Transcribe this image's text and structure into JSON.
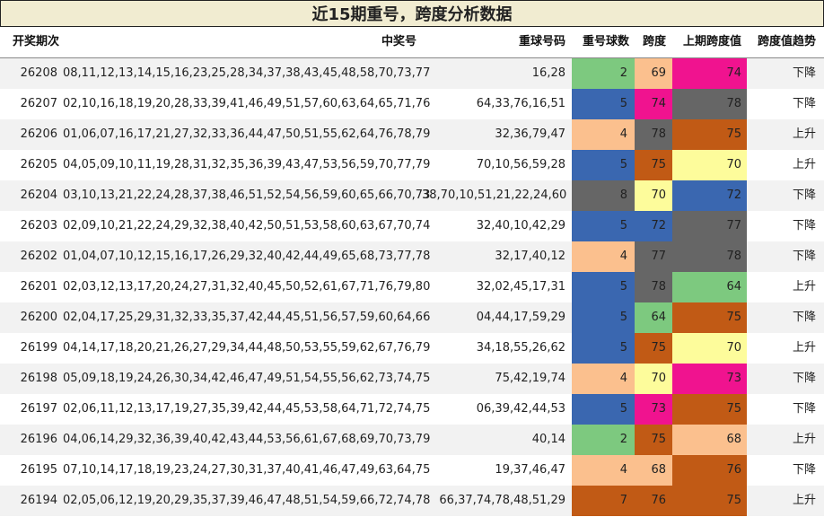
{
  "title": "近15期重号，跨度分析数据",
  "headers": {
    "period": "开奖期次",
    "main": "中奖号",
    "heavy": "重球号码",
    "count": "重号球数",
    "span": "跨度",
    "prev_span": "上期跨度值",
    "trend": "跨度值趋势"
  },
  "colors": {
    "green": "#7dc97f",
    "blue": "#3a67b0",
    "peach": "#fbc08e",
    "gray": "#666666",
    "magenta": "#f0138f",
    "orange": "#c15a15",
    "yellow": "#fdfc9b"
  },
  "rows": [
    {
      "period": "26208",
      "main": "08,11,12,13,14,15,16,23,25,28,34,37,38,43,45,48,58,70,73,77",
      "heavy": "16,28",
      "count": "2",
      "count_color": "green",
      "span": "69",
      "span_color": "peach",
      "prev_span": "74",
      "prev_color": "magenta",
      "trend": "下降"
    },
    {
      "period": "26207",
      "main": "02,10,16,18,19,20,28,33,39,41,46,49,51,57,60,63,64,65,71,76",
      "heavy": "64,33,76,16,51",
      "count": "5",
      "count_color": "blue",
      "span": "74",
      "span_color": "magenta",
      "prev_span": "78",
      "prev_color": "gray",
      "trend": "下降"
    },
    {
      "period": "26206",
      "main": "01,06,07,16,17,21,27,32,33,36,44,47,50,51,55,62,64,76,78,79",
      "heavy": "32,36,79,47",
      "count": "4",
      "count_color": "peach",
      "span": "78",
      "span_color": "gray",
      "prev_span": "75",
      "prev_color": "orange",
      "trend": "上升"
    },
    {
      "period": "26205",
      "main": "04,05,09,10,11,19,28,31,32,35,36,39,43,47,53,56,59,70,77,79",
      "heavy": "70,10,56,59,28",
      "count": "5",
      "count_color": "blue",
      "span": "75",
      "span_color": "orange",
      "prev_span": "70",
      "prev_color": "yellow",
      "trend": "上升"
    },
    {
      "period": "26204",
      "main": "03,10,13,21,22,24,28,37,38,46,51,52,54,56,59,60,65,66,70,73",
      "heavy": "38,70,10,51,21,22,24,60",
      "count": "8",
      "count_color": "gray",
      "span": "70",
      "span_color": "yellow",
      "prev_span": "72",
      "prev_color": "blue",
      "trend": "下降"
    },
    {
      "period": "26203",
      "main": "02,09,10,21,22,24,29,32,38,40,42,50,51,53,58,60,63,67,70,74",
      "heavy": "32,40,10,42,29",
      "count": "5",
      "count_color": "blue",
      "span": "72",
      "span_color": "blue",
      "prev_span": "77",
      "prev_color": "gray",
      "trend": "下降"
    },
    {
      "period": "26202",
      "main": "01,04,07,10,12,15,16,17,26,29,32,40,42,44,49,65,68,73,77,78",
      "heavy": "32,17,40,12",
      "count": "4",
      "count_color": "peach",
      "span": "77",
      "span_color": "gray",
      "prev_span": "78",
      "prev_color": "gray",
      "trend": "下降"
    },
    {
      "period": "26201",
      "main": "02,03,12,13,17,20,24,27,31,32,40,45,50,52,61,67,71,76,79,80",
      "heavy": "32,02,45,17,31",
      "count": "5",
      "count_color": "blue",
      "span": "78",
      "span_color": "gray",
      "prev_span": "64",
      "prev_color": "green",
      "trend": "上升"
    },
    {
      "period": "26200",
      "main": "02,04,17,25,29,31,32,33,35,37,42,44,45,51,56,57,59,60,64,66",
      "heavy": "04,44,17,59,29",
      "count": "5",
      "count_color": "blue",
      "span": "64",
      "span_color": "green",
      "prev_span": "75",
      "prev_color": "orange",
      "trend": "下降"
    },
    {
      "period": "26199",
      "main": "04,14,17,18,20,21,26,27,29,34,44,48,50,53,55,59,62,67,76,79",
      "heavy": "34,18,55,26,62",
      "count": "5",
      "count_color": "blue",
      "span": "75",
      "span_color": "orange",
      "prev_span": "70",
      "prev_color": "yellow",
      "trend": "上升"
    },
    {
      "period": "26198",
      "main": "05,09,18,19,24,26,30,34,42,46,47,49,51,54,55,56,62,73,74,75",
      "heavy": "75,42,19,74",
      "count": "4",
      "count_color": "peach",
      "span": "70",
      "span_color": "yellow",
      "prev_span": "73",
      "prev_color": "magenta",
      "trend": "下降"
    },
    {
      "period": "26197",
      "main": "02,06,11,12,13,17,19,27,35,39,42,44,45,53,58,64,71,72,74,75",
      "heavy": "06,39,42,44,53",
      "count": "5",
      "count_color": "blue",
      "span": "73",
      "span_color": "magenta",
      "prev_span": "75",
      "prev_color": "orange",
      "trend": "下降"
    },
    {
      "period": "26196",
      "main": "04,06,14,29,32,36,39,40,42,43,44,53,56,61,67,68,69,70,73,79",
      "heavy": "40,14",
      "count": "2",
      "count_color": "green",
      "span": "75",
      "span_color": "orange",
      "prev_span": "68",
      "prev_color": "peach",
      "trend": "上升"
    },
    {
      "period": "26195",
      "main": "07,10,14,17,18,19,23,24,27,30,31,37,40,41,46,47,49,63,64,75",
      "heavy": "19,37,46,47",
      "count": "4",
      "count_color": "peach",
      "span": "68",
      "span_color": "peach",
      "prev_span": "76",
      "prev_color": "orange",
      "trend": "下降"
    },
    {
      "period": "26194",
      "main": "02,05,06,12,19,20,29,35,37,39,46,47,48,51,54,59,66,72,74,78",
      "heavy": "66,37,74,78,48,51,29",
      "count": "7",
      "count_color": "orange",
      "span": "76",
      "span_color": "orange",
      "prev_span": "75",
      "prev_color": "orange",
      "trend": "上升"
    }
  ]
}
